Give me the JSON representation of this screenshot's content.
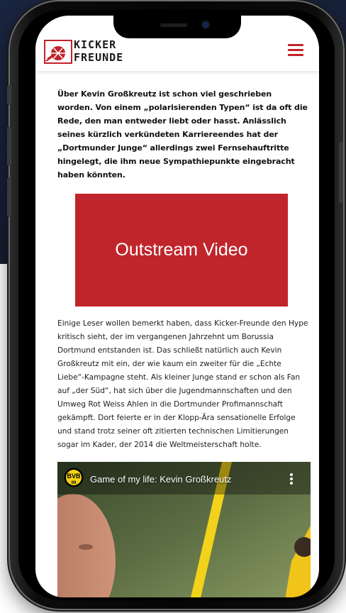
{
  "site": {
    "logo_line1": "KICKER",
    "logo_line2": "FREUNDE",
    "menu_icon": "hamburger-menu-icon",
    "brand_color": "#c0242a"
  },
  "article": {
    "intro": "Über Kevin Großkreutz ist schon viel geschrieben worden. Von einem „polarisierenden Typen“ ist da oft die Rede, den man entweder liebt oder hasst. Anlässlich seines kürzlich verkündeten Karriereendes hat der „Dortmunder Junge“ allerdings zwei Fernsehauftritte hingelegt, die ihm neue Sympathiepunkte eingebracht haben könnten.",
    "ad_label": "Outstream Video",
    "body": "Einige Leser wollen bemerkt haben, dass Kicker-Freunde den Hype kritisch sieht, der im vergangenen Jahrzehnt um Borussia Dortmund entstanden ist. Das schließt natürlich auch Kevin Großkreutz mit ein, der wie kaum ein zweiter für die „Echte Liebe“-Kampagne steht. Als kleiner Junge stand er schon als Fan auf „der Süd“, hat sich über die Jugendmannschaften und den Umweg Rot Weiss Ahlen in die Dortmunder Profimannschaft gekämpft. Dort feierte er in der Klopp-Ära sensationelle Erfolge und stand trotz seiner oft zitierten technischen Limitierungen sogar im Kader, der 2014 die Weltmeisterschaft holte."
  },
  "video": {
    "title": "Game of my life: Kevin Großkreutz",
    "channel_logo": "BVB",
    "channel_logo_year": "09",
    "menu_icon": "more-vertical-icon"
  }
}
